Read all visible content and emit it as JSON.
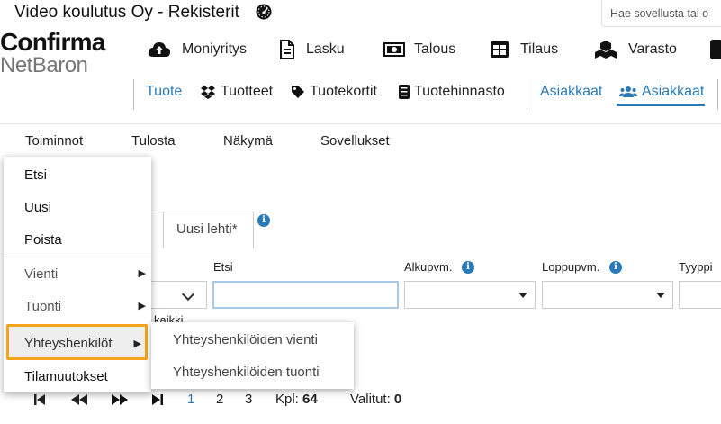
{
  "header": {
    "company_title": "Video koulutus Oy - Rekisterit",
    "search_placeholder": "Hae sovellusta tai o",
    "logo_line1": "Confirma",
    "logo_line2": "NetBaron"
  },
  "main_nav": [
    {
      "label": "Moniyritys",
      "icon": "cloud-upload-icon"
    },
    {
      "label": "Lasku",
      "icon": "document-icon"
    },
    {
      "label": "Talous",
      "icon": "money-icon"
    },
    {
      "label": "Tilaus",
      "icon": "grid-icon"
    },
    {
      "label": "Varasto",
      "icon": "cubes-icon"
    }
  ],
  "sub_nav": {
    "group1_label": "Tuote",
    "items": [
      {
        "label": "Tuotteet",
        "icon": "dropbox-icon"
      },
      {
        "label": "Tuotekortit",
        "icon": "tag-icon"
      },
      {
        "label": "Tuotehinnasto",
        "icon": "list-icon"
      }
    ],
    "group2_label": "Asiakkaat",
    "active_item": {
      "label": "Asiakkaat",
      "icon": "users-icon"
    }
  },
  "menu_bar": [
    "Toiminnot",
    "Tulosta",
    "Näkymä",
    "Sovellukset"
  ],
  "dropdown": {
    "items": [
      "Etsi",
      "Uusi",
      "Poista"
    ],
    "sub_items": [
      {
        "label": "Vienti"
      },
      {
        "label": "Tuonti"
      }
    ],
    "highlighted": "Yhteyshenkilöt",
    "last_item": "Tilamuutokset"
  },
  "submenu": [
    "Yhteyshenkilöiden vienti",
    "Yhteyshenkilöiden tuonti"
  ],
  "tab": {
    "label": "Uusi lehti*"
  },
  "filters": {
    "search_label": "Etsi",
    "start_label": "Alkupvm.",
    "end_label": "Loppupvm.",
    "type_label": "Tyyppi",
    "all_text": "kaikki"
  },
  "pager": {
    "pages": [
      "1",
      "2",
      "3"
    ],
    "count_label": "Kpl:",
    "count_value": "64",
    "selected_label": "Valitut:",
    "selected_value": "0"
  },
  "colors": {
    "accent": "#2a7ab8",
    "highlight": "#f4a31a"
  }
}
